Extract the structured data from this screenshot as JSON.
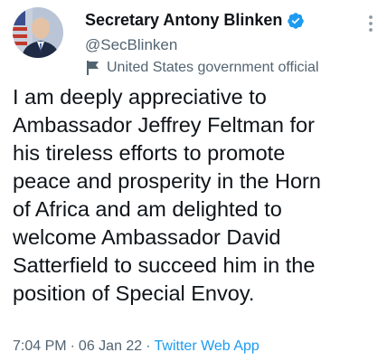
{
  "author": {
    "display_name": "Secretary Antony Blinken",
    "handle": "@SecBlinken",
    "label": "United States government official",
    "verified": true,
    "avatar_icon": "profile-photo"
  },
  "tweet": {
    "lines": [
      "I am deeply appreciative to",
      "Ambassador Jeffrey Feltman for",
      "his tireless efforts to promote",
      "peace and prosperity in the Horn",
      "of Africa and am delighted to",
      "welcome Ambassador David",
      "Satterfield to succeed him in the",
      "position of Special Envoy."
    ]
  },
  "meta": {
    "time": "7:04 PM",
    "separator": "·",
    "date": "06 Jan 22",
    "source": "Twitter Web App"
  },
  "colors": {
    "text": "#0f1419",
    "secondary": "#536471",
    "link": "#1d9bf0",
    "verified": "#1d9bf0"
  }
}
